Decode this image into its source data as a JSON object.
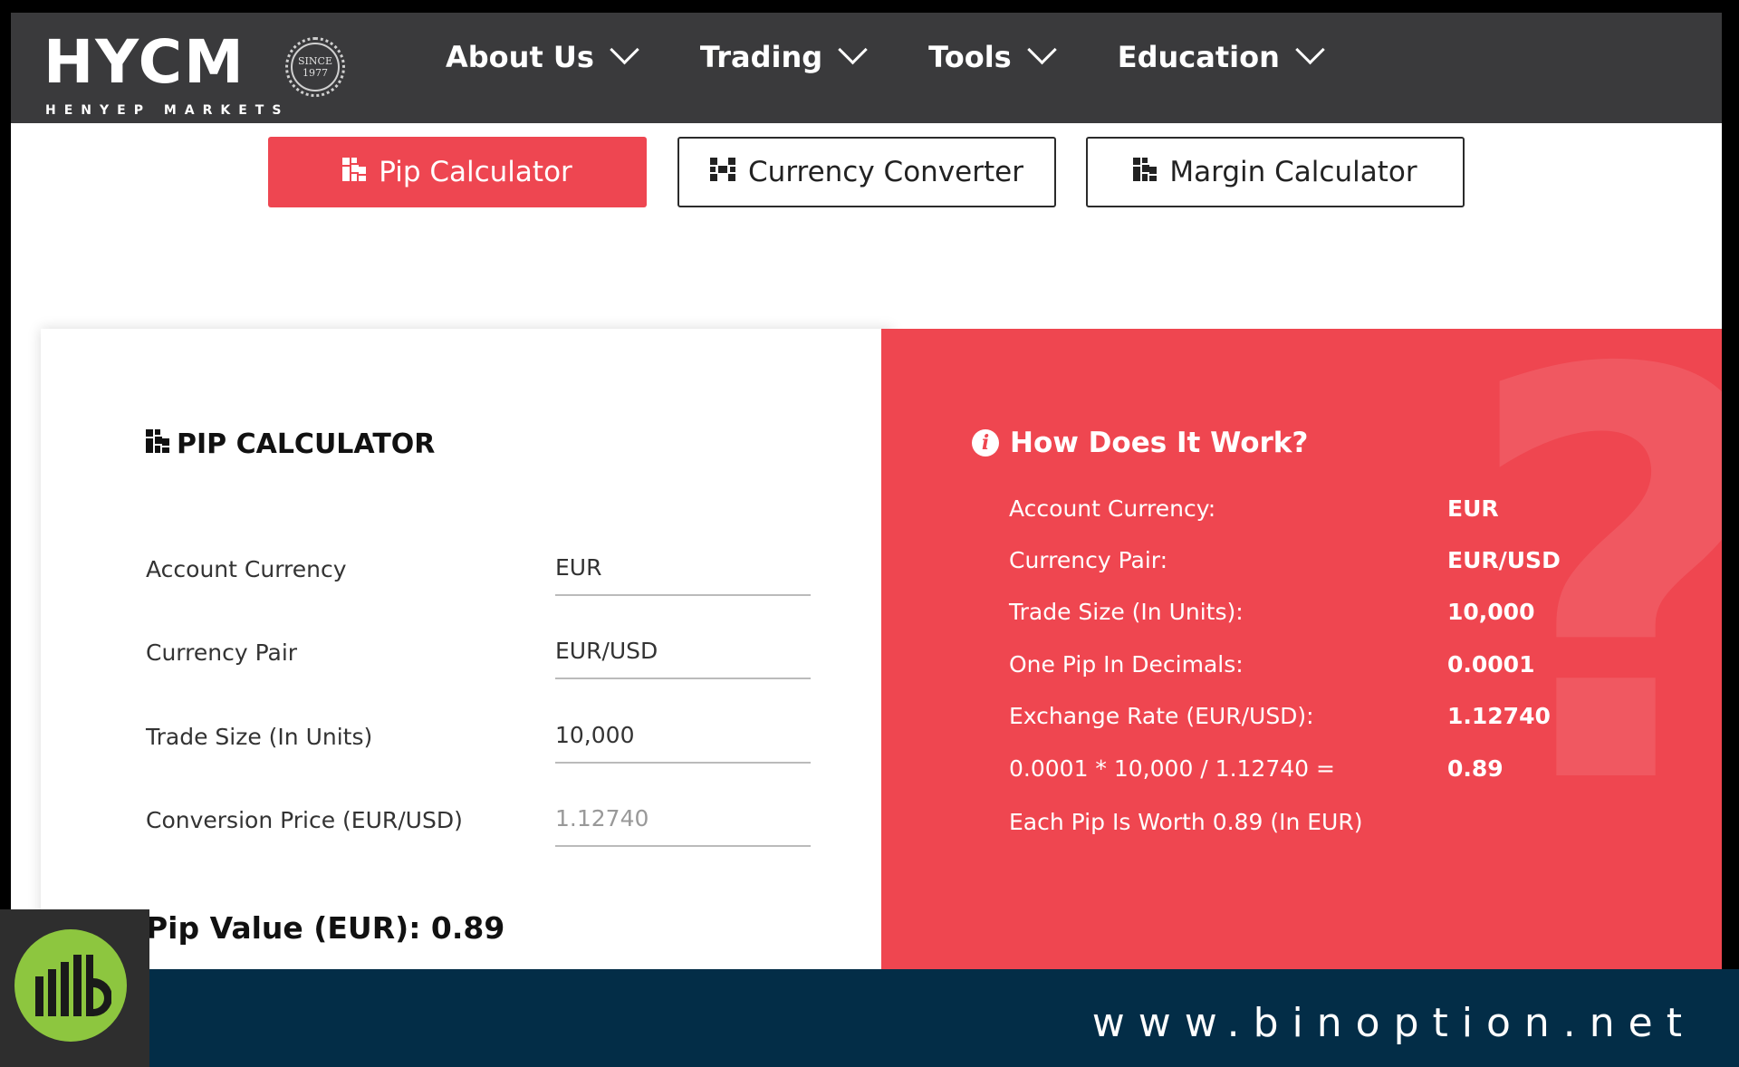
{
  "brand": {
    "logo_main": "HYCM",
    "logo_sub": "HENYEP MARKETS",
    "seal_line1": "SINCE",
    "seal_line2": "1977"
  },
  "nav": {
    "items": [
      {
        "label": "About Us"
      },
      {
        "label": "Trading"
      },
      {
        "label": "Tools"
      },
      {
        "label": "Education"
      }
    ]
  },
  "tabs": {
    "pip": "Pip Calculator",
    "converter": "Currency Converter",
    "margin": "Margin Calculator",
    "active": "pip"
  },
  "calculator": {
    "title": "PIP CALCULATOR",
    "fields": [
      {
        "label": "Account Currency",
        "value": "EUR"
      },
      {
        "label": "Currency Pair",
        "value": "EUR/USD"
      },
      {
        "label": "Trade Size (In Units)",
        "value": "10,000"
      },
      {
        "label": "Conversion Price (EUR/USD)",
        "value": "1.12740"
      }
    ],
    "result": "Pip Value (EUR): 0.89"
  },
  "how": {
    "title": "How Does It Work?",
    "rows": [
      {
        "k": "Account Currency:",
        "v": "EUR"
      },
      {
        "k": "Currency Pair:",
        "v": "EUR/USD"
      },
      {
        "k": "Trade Size (In Units):",
        "v": "10,000"
      },
      {
        "k": "One Pip In Decimals:",
        "v": "0.0001"
      },
      {
        "k": "Exchange Rate (EUR/USD):",
        "v": "1.12740"
      },
      {
        "k": "0.0001 * 10,000 / 1.12740 =",
        "v": "0.89"
      },
      {
        "k": "Each Pip Is Worth 0.89 (In EUR)",
        "v": ""
      }
    ]
  },
  "footer": {
    "url": "www.binoption.net"
  },
  "colors": {
    "accent_red": "#ee4651",
    "nav_bg": "#3a3a3c",
    "footer_bg": "#032d47",
    "badge_green": "#8dc63f"
  }
}
